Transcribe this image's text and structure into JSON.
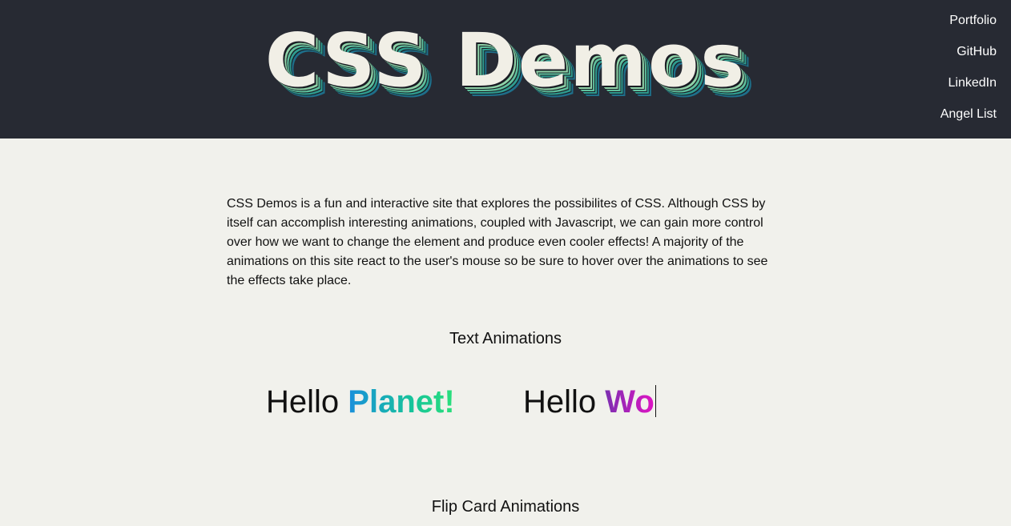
{
  "header": {
    "title": "CSS Demos",
    "nav": [
      "Portfolio",
      "GitHub",
      "LinkedIn",
      "Angel List"
    ]
  },
  "intro": "CSS Demos is a fun and interactive site that explores the possibilites of CSS. Although CSS by itself can accomplish interesting animations, coupled with Javascript, we can gain more control over how we want to change the element and produce even cooler effects! A majority of the animations on this site react to the user's mouse so be sure to hover over the animations to see the effects take place.",
  "sections": {
    "text_animations": "Text Animations",
    "flip_card_animations": "Flip Card Animations"
  },
  "demos": {
    "planet": {
      "prefix": "Hello",
      "word": "Planet!"
    },
    "world": {
      "prefix": "Hello",
      "word": "Wo"
    }
  },
  "colors": {
    "header_bg": "#272a33",
    "page_bg": "#f1f1ec",
    "gradient_green": [
      "#1a8fdc",
      "#2be07a"
    ],
    "gradient_purple": [
      "#7b2fb0",
      "#e014c4"
    ]
  }
}
